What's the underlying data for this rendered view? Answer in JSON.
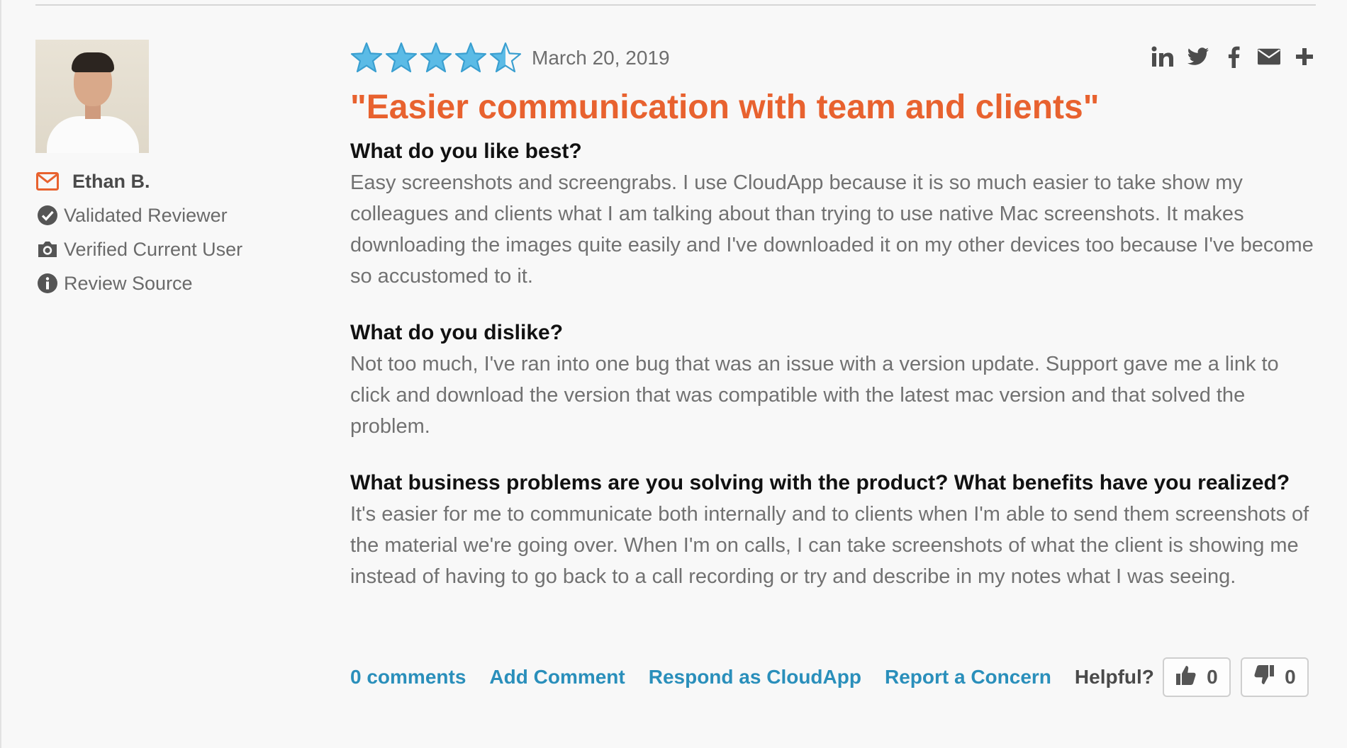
{
  "reviewer": {
    "name": "Ethan B.",
    "badges": [
      {
        "icon": "check-circle-icon",
        "label": "Validated Reviewer"
      },
      {
        "icon": "camera-icon",
        "label": "Verified Current User"
      },
      {
        "icon": "info-circle-icon",
        "label": "Review Source"
      }
    ]
  },
  "review": {
    "rating": 4.5,
    "rating_max": 5,
    "date": "March 20, 2019",
    "title": "\"Easier communication with team and clients\"",
    "sections": [
      {
        "question": "What do you like best?",
        "answer": "Easy screenshots and screengrabs. I use CloudApp because it is so much easier to take show my colleagues and clients what I am talking about than trying to use native Mac screenshots. It makes downloading the images quite easily and I've downloaded it on my other devices too because I've become so accustomed to it."
      },
      {
        "question": "What do you dislike?",
        "answer": "Not too much, I've ran into one bug that was an issue with a version update. Support gave me a link to click and download the version that was compatible with the latest mac version and that solved the problem."
      },
      {
        "question": "What business problems are you solving with the product? What benefits have you realized?",
        "answer": "It's easier for me to communicate both internally and to clients when I'm able to send them screenshots of the material we're going over. When I'm on calls, I can take screenshots of what the client is showing me instead of having to go back to a call recording or try and describe in my notes what I was seeing."
      }
    ]
  },
  "share_icons": [
    "linkedin-icon",
    "twitter-icon",
    "facebook-icon",
    "email-icon",
    "plus-icon"
  ],
  "footer": {
    "comments": "0 comments",
    "add_comment": "Add Comment",
    "respond": "Respond as CloudApp",
    "report": "Report a Concern",
    "helpful_label": "Helpful?",
    "upvotes": "0",
    "downvotes": "0"
  },
  "colors": {
    "title": "#e8622f",
    "link": "#2a8fbb",
    "star": "#5bbbe6"
  }
}
